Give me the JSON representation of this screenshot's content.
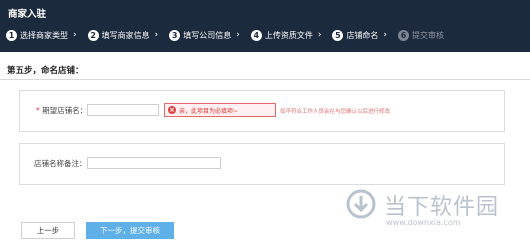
{
  "header": {
    "title": "商家入驻",
    "steps": [
      {
        "num": "1",
        "label": "选择商家类型"
      },
      {
        "num": "2",
        "label": "填写商家信息"
      },
      {
        "num": "3",
        "label": "填写公司信息"
      },
      {
        "num": "4",
        "label": "上传资质文件"
      },
      {
        "num": "5",
        "label": "店铺命名"
      },
      {
        "num": "6",
        "label": "提交审核"
      }
    ]
  },
  "section": {
    "title": "第五步，命名店铺："
  },
  "form": {
    "store_name": {
      "required_mark": "*",
      "label": "期望店铺名：",
      "value": "",
      "error": "亲，此项目为必填项~",
      "hint": "如不符合工作人员会在与您确认以后进行修改"
    },
    "store_remark": {
      "label": "店铺名称备注：",
      "value": ""
    }
  },
  "buttons": {
    "prev": "上一步",
    "next": "下一步，提交审核"
  },
  "watermark": {
    "cn": "当下软件园",
    "en": "www.downxia.com"
  },
  "colors": {
    "header_bg": "#1c2a3d",
    "primary_button": "#5fb0e8",
    "error": "#e0403e"
  }
}
